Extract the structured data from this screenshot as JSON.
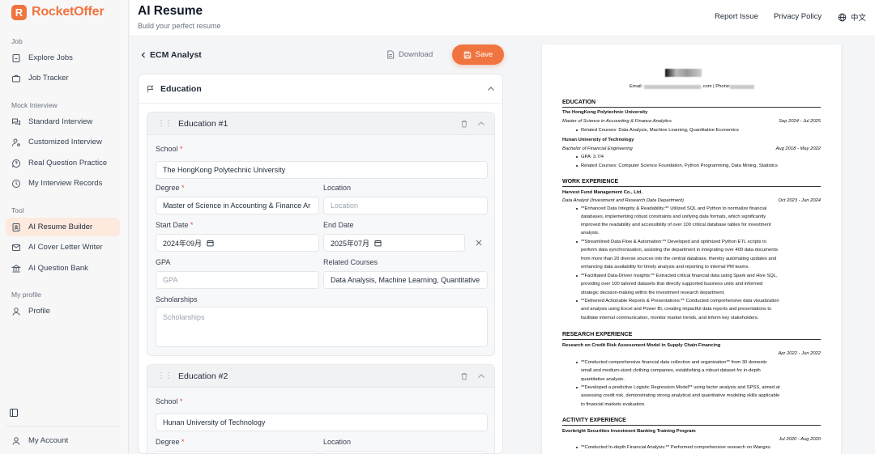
{
  "brand": {
    "logo_letter": "R",
    "name": "RocketOffer"
  },
  "sidebar": {
    "sections": [
      {
        "label": "Job"
      },
      {
        "label": "Mock Interview"
      },
      {
        "label": "Tool"
      },
      {
        "label": "My profile"
      }
    ],
    "items": [
      {
        "label": "Explore Jobs",
        "icon": "building-icon"
      },
      {
        "label": "Job Tracker",
        "icon": "briefcase-icon"
      },
      {
        "label": "Standard Interview",
        "icon": "chat-icon"
      },
      {
        "label": "Customized Interview",
        "icon": "user-settings-icon"
      },
      {
        "label": "Real Question Practice",
        "icon": "message-question-icon"
      },
      {
        "label": "My Interview Records",
        "icon": "clock-icon"
      },
      {
        "label": "AI Resume Builder",
        "icon": "file-user-icon",
        "active": true
      },
      {
        "label": "AI Cover Letter Writer",
        "icon": "mail-icon"
      },
      {
        "label": "AI Question Bank",
        "icon": "bank-icon"
      },
      {
        "label": "Profile",
        "icon": "user-icon"
      }
    ],
    "account": "My Account"
  },
  "header": {
    "title": "AI Resume",
    "subtitle": "Build your perfect resume",
    "report": "Report Issue",
    "privacy": "Privacy Policy",
    "language": "中文"
  },
  "editor": {
    "back_label": "ECM Analyst",
    "download_label": "Download",
    "save_label": "Save",
    "section_title": "Education",
    "educations": [
      {
        "title": "Education #1",
        "school_label": "School",
        "school": "The HongKong Polytechnic University",
        "degree_label": "Degree",
        "degree": "Master of Science in Accounting & Finance Ar",
        "location_label": "Location",
        "location_placeholder": "Location",
        "start_label": "Start Date",
        "start": "2024年09月",
        "end_label": "End Date",
        "end": "2025年07月",
        "gpa_label": "GPA",
        "gpa_placeholder": "GPA",
        "courses_label": "Related Courses",
        "courses": "Data Analysis, Machine Learning, Quantitative",
        "scholarships_label": "Scholarships",
        "scholarships_placeholder": "Scholarships"
      },
      {
        "title": "Education #2",
        "school_label": "School",
        "school": "Hunan University of Technology",
        "degree_label": "Degree",
        "location_label": "Location"
      }
    ]
  },
  "resume": {
    "contact_prefix": "Email:",
    "contact_mid": ".com | Phone:",
    "sections": {
      "education": "EDUCATION",
      "work": "WORK EXPERIENCE",
      "research": "RESEARCH EXPERIENCE",
      "activity": "ACTIVITY EXPERIENCE"
    },
    "edu1": {
      "school": "The HongKong Polytechnic University",
      "degree": "Master of Science in Accounting & Finance Analytics",
      "dates": "Sep 2024 - Jul 2025",
      "courses": "Related Courses: Data Analysis, Machine Learning, Quantitative Economics"
    },
    "edu2": {
      "school": "Hunan University of Technology",
      "degree": "Bachelor of Financial Engineering",
      "dates": "Aug 2018 - May 2022",
      "gpa": "GPA: 3.7/4",
      "courses": "Related Courses: Computer Science Foundation, Python Programming, Data Mining, Statistics"
    },
    "work": {
      "company": "Harvest Fund Management Co., Ltd.",
      "role": "Data Analyst (Investment and Research Data Department)",
      "dates": "Oct 2023 - Jun 2024",
      "lines": [
        "**Enhanced Data Integrity & Readability:** Utilized SQL and Python to normalize financial",
        "databases, implementing robust constraints and unifying data formats, which significantly",
        "improved the readability and accessibility of over 100 critical database tables for investment",
        "analysis.",
        "**Streamlined Data Flow & Automation:** Developed and optimized Python ETL scripts to",
        "perform data synchronization, assisting the department in integrating over 400 data documents",
        "from more than 20 diverse sources into the central database, thereby automating updates and",
        "enhancing data availability for timely analysis and reporting to internal PM teams.",
        "**Facilitated Data-Driven Insights:** Extracted critical financial data using Spark and Hive SQL,",
        "providing over 100 tailored datasets that directly supported business units and informed",
        "strategic decision-making within the investment research department.",
        "**Delivered Actionable Reports & Presentations:** Conducted comprehensive data visualization",
        "and analysis using Excel and Power BI, creating impactful data reports and presentations to",
        "facilitate internal communication, monitor market trends, and inform key stakeholders."
      ]
    },
    "research": {
      "title": "Research on Credit Risk Assessment Model in Supply Chain Financing",
      "dates": "Apr 2022 - Jun 2022",
      "lines": [
        "**Conducted comprehensive financial data collection and organization** from 30 domestic",
        "small and medium-sized clothing companies, establishing a robust dataset for in-depth",
        "quantitative analysis.",
        "**Developed a predictive Logistic Regression Model** using factor analysis and SPSS, aimed at",
        "assessing credit risk, demonstrating strong analytical and quantitative modeling skills applicable",
        "to financial markets evaluation."
      ]
    },
    "activity": {
      "title": "Everbright Securities Investment Banking Training Program",
      "dates": "Jul 2020 - Aug 2020",
      "lines": [
        "**Conducted In-depth Financial Analysis:** Performed comprehensive research on Wangsu"
      ]
    }
  }
}
